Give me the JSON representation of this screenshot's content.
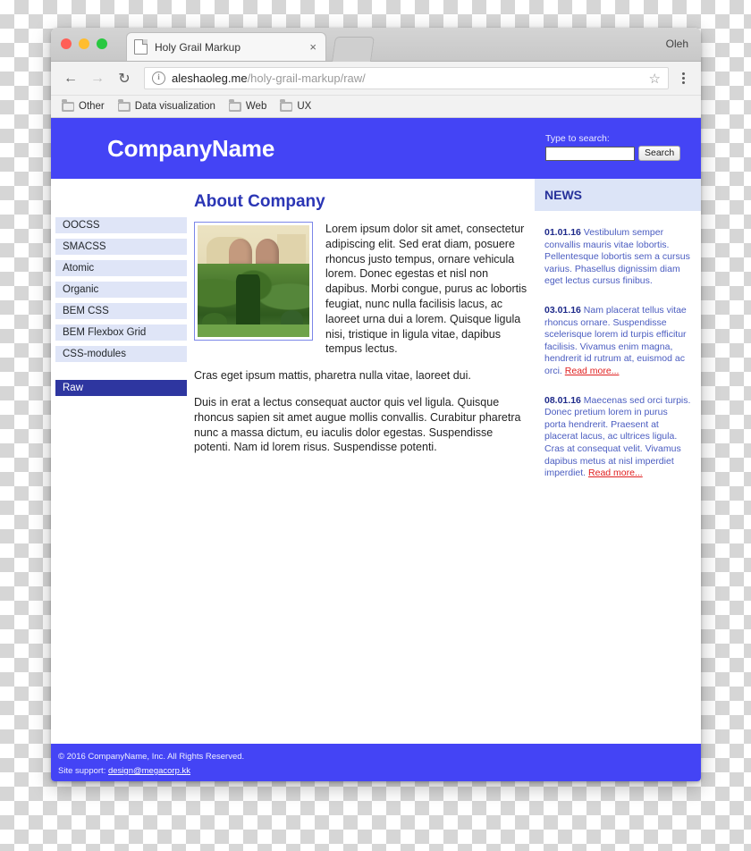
{
  "browser": {
    "tab": {
      "title": "Holy Grail Markup",
      "favicon": "page-icon",
      "close": "×"
    },
    "profile_name": "Oleh",
    "nav": {
      "back": "←",
      "forward": "→",
      "reload": "↻"
    },
    "omnibox": {
      "info_icon": "i",
      "host": "aleshaoleg.me",
      "path": "/holy-grail-markup/raw/",
      "star": "☆"
    },
    "bookmarks": [
      {
        "label": "Other"
      },
      {
        "label": "Data visualization"
      },
      {
        "label": "Web"
      },
      {
        "label": "UX"
      }
    ]
  },
  "site": {
    "brand": "CompanyName",
    "search": {
      "label": "Type to search:",
      "value": "",
      "placeholder": "",
      "button": "Search"
    },
    "nav_items": [
      {
        "label": "OOCSS",
        "active": false
      },
      {
        "label": "SMACSS",
        "active": false
      },
      {
        "label": "Atomic",
        "active": false
      },
      {
        "label": "Organic",
        "active": false
      },
      {
        "label": "BEM CSS",
        "active": false
      },
      {
        "label": "BEM Flexbox Grid",
        "active": false
      },
      {
        "label": "CSS-modules",
        "active": false
      },
      {
        "label": "Raw",
        "active": true
      }
    ],
    "main": {
      "title": "About Company",
      "figure_alt": "resort-garden-photo",
      "paragraphs": [
        "Lorem ipsum dolor sit amet, consectetur adipiscing elit. Sed erat diam, posuere rhoncus justo tempus, ornare vehicula lorem. Donec egestas et nisl non dapibus. Morbi congue, purus ac lobortis feugiat, nunc nulla facilisis lacus, ac laoreet urna dui a lorem. Quisque ligula nisi, tristique in ligula vitae, dapibus tempus lectus.",
        "Cras eget ipsum mattis, pharetra nulla vitae, laoreet dui.",
        "Duis in erat a lectus consequat auctor quis vel ligula. Quisque rhoncus sapien sit amet augue mollis convallis. Curabitur pharetra nunc a massa dictum, eu iaculis dolor egestas. Suspendisse potenti. Nam id lorem risus. Suspendisse potenti."
      ]
    },
    "news": {
      "heading": "NEWS",
      "items": [
        {
          "date": "01.01.16",
          "text": "Vestibulum semper convallis mauris vitae lobortis. Pellentesque lobortis sem a cursus varius. Phasellus dignissim diam eget lectus cursus finibus.",
          "read_more": ""
        },
        {
          "date": "03.01.16",
          "text": "Nam placerat tellus vitae rhoncus ornare. Suspendisse scelerisque lorem id turpis efficitur facilisis. Vivamus enim magna, hendrerit id rutrum at, euismod ac orci.",
          "read_more": "Read more..."
        },
        {
          "date": "08.01.16",
          "text": "Maecenas sed orci turpis. Donec pretium lorem in purus porta hendrerit. Praesent at placerat lacus, ac ultrices ligula. Cras at consequat velit. Vivamus dapibus metus at nisl imperdiet imperdiet.",
          "read_more": "Read more..."
        }
      ]
    },
    "footer": {
      "copyright": "© 2016 CompanyName, Inc. All Rights Reserved.",
      "support_label": "Site support:",
      "support_email": "design@megacorp.kk"
    }
  },
  "colors": {
    "brand_blue": "#4444f5",
    "dark_navy": "#2e36a0",
    "nav_item_bg": "#dfe5f7",
    "news_head_bg": "#dce4f7",
    "news_text": "#4a5cc0",
    "read_more": "#e02020",
    "heading": "#2b36b5"
  }
}
